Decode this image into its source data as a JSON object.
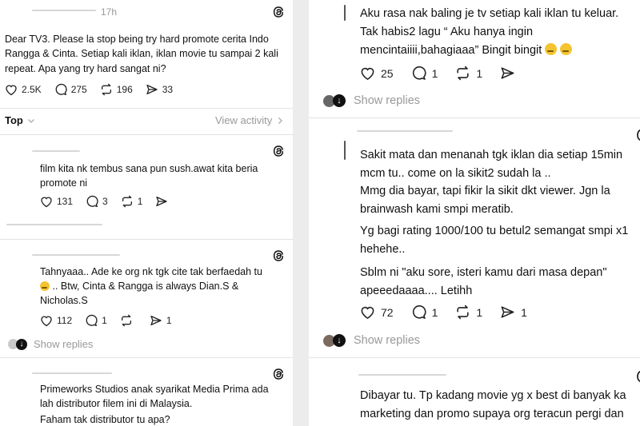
{
  "left": {
    "post": {
      "time": "17h",
      "body_lines": [
        "Dear TV3. Please la stop being try hard promote cerita Indo",
        "Rangga & Cinta. Setiap kali iklan, iklan movie tu sampai 2 kali",
        "repeat. Apa yang try hard sangat ni?"
      ],
      "likes": "2.5K",
      "comments": "275",
      "reposts": "196",
      "shares": "33"
    },
    "sort": {
      "label": "Top",
      "view_activity": "View activity"
    },
    "replies": [
      {
        "lines": [
          "film kita nk tembus sana pun sush.awat kita beria",
          "promote ni"
        ],
        "likes": "131",
        "comments": "3",
        "reposts": "1",
        "shares": ""
      },
      {
        "lines": [
          "Tahnyaaa.. Ade ke org nk tgk cite tak berfaedah tu",
          ".. Btw, Cinta & Rangga is always Dian.S &",
          "Nicholas.S"
        ],
        "likes": "112",
        "comments": "1",
        "reposts": "",
        "shares": "1",
        "show_replies": "Show replies"
      },
      {
        "lines": [
          "Primeworks Studios anak syarikat Media Prima ada",
          "lah distributor filem ini di Malaysia.",
          "Faham tak distributor tu apa?"
        ]
      }
    ]
  },
  "right": {
    "reply1": {
      "lines": [
        "Aku rasa nak baling je tv setiap kali iklan tu keluar.",
        "Tak habis2 lagu “ Aku hanya ingin",
        "mencintaiiii,bahagiaaa” Bingit bingit"
      ],
      "likes": "25",
      "comments": "1",
      "reposts": "1",
      "show_replies": "Show replies"
    },
    "reply2": {
      "paragraphs": [
        [
          "Sakit mata dan menanah tgk iklan dia setiap 15min",
          "mcm tu.. come on la sikit2 sudah la .."
        ],
        [
          "Mmg dia bayar, tapi fikir la sikit dkt viewer. Jgn la",
          "brainwash kami smpi meratib."
        ],
        [
          "Yg bagi rating 1000/100 tu betul2 semangat smpi x1",
          "hehehe.."
        ],
        [
          "Sblm ni \"aku sore, isteri kamu dari masa depan\"",
          "apeeedaaaa.... Letihh"
        ]
      ],
      "likes": "72",
      "comments": "1",
      "reposts": "1",
      "shares": "1",
      "show_replies": "Show replies"
    },
    "reply3": {
      "lines": [
        "Dibayar tu. Tp kadang movie yg x best di banyak ka",
        "marketing dan promo supaya org teracun pergi dan"
      ]
    }
  },
  "colors": {
    "background": "#ececec",
    "text": "#101010",
    "muted": "#999999"
  },
  "icons": [
    "heart-icon",
    "comment-icon",
    "repost-icon",
    "share-icon",
    "threads-logo-icon",
    "chevron-down-icon",
    "chevron-right-icon"
  ]
}
